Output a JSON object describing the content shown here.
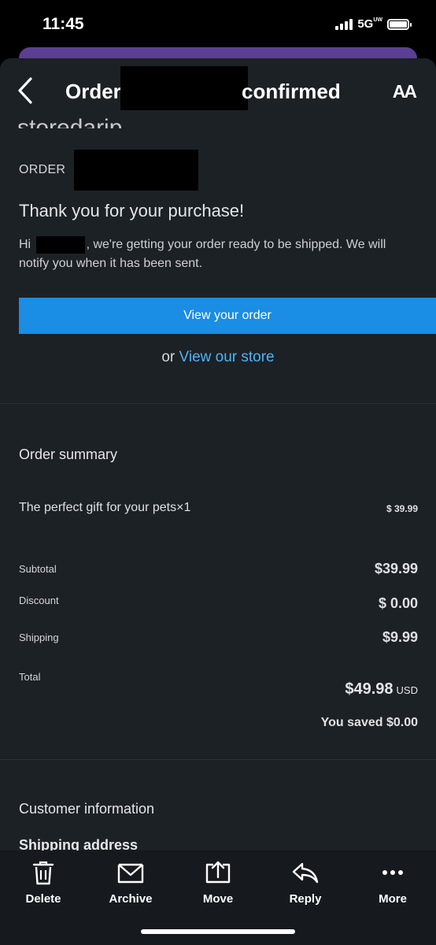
{
  "status": {
    "time": "11:45",
    "network": "5G",
    "network_suffix": "UW"
  },
  "nav": {
    "title_prefix": "Order",
    "title_suffix": "confirmed",
    "text_size_label": "AA"
  },
  "email": {
    "order_label": "ORDER",
    "thanks": "Thank you for your purchase!",
    "greeting_prefix": "Hi",
    "greeting_body": ", we're getting your order ready to be shipped. We will notify you when it has been sent.",
    "view_order_button": "View your order",
    "store_prefix": "or",
    "store_link": "View our store"
  },
  "summary": {
    "title": "Order summary",
    "item": {
      "name": "The perfect gift for your pets×1",
      "price": "$ 39.99"
    },
    "rows": [
      {
        "label": "Subtotal",
        "value": "$39.99"
      },
      {
        "label": "Discount",
        "value": "$ 0.00"
      },
      {
        "label": "Shipping",
        "value": "$9.99"
      }
    ],
    "total_label": "Total",
    "total_value": "$49.98",
    "total_currency": "USD",
    "saved": "You saved $0.00"
  },
  "customer": {
    "title": "Customer information",
    "shipping_address": "Shipping address"
  },
  "toolbar": [
    {
      "label": "Delete",
      "icon": "trash-icon"
    },
    {
      "label": "Archive",
      "icon": "archive-icon"
    },
    {
      "label": "Move",
      "icon": "move-icon"
    },
    {
      "label": "Reply",
      "icon": "reply-icon"
    },
    {
      "label": "More",
      "icon": "more-icon"
    }
  ]
}
